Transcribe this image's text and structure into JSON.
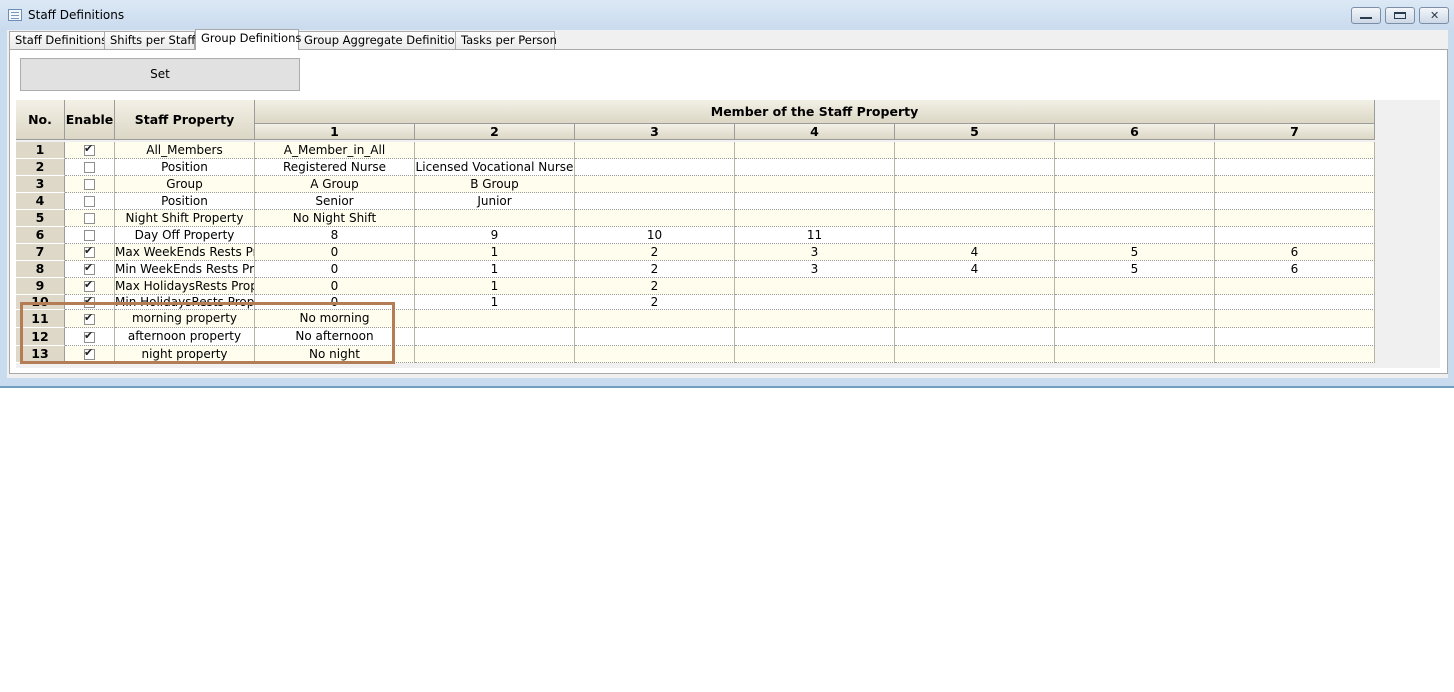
{
  "window": {
    "title": "Staff Definitions",
    "icon": "table-window-icon"
  },
  "tabs": [
    {
      "label": "Staff Definitions"
    },
    {
      "label": "Shifts per Staff"
    },
    {
      "label": "Group Definitions"
    },
    {
      "label": "Group Aggregate Definitions"
    },
    {
      "label": "Tasks per Person"
    }
  ],
  "active_tab": "Group Definitions",
  "set_button": {
    "label": "Set"
  },
  "grid": {
    "headers": {
      "no": "No.",
      "enable": "Enable",
      "property": "Staff Property",
      "members": "Member of the Staff Property"
    },
    "member_columns": [
      "1",
      "2",
      "3",
      "4",
      "5",
      "6",
      "7"
    ],
    "rows": [
      {
        "no": "1",
        "enabled": true,
        "property": "All_Members",
        "members": [
          "A_Member_in_All",
          "",
          "",
          "",
          "",
          "",
          ""
        ]
      },
      {
        "no": "2",
        "enabled": false,
        "property": "Position",
        "members": [
          "Registered Nurse",
          "Licensed Vocational Nurse",
          "",
          "",
          "",
          "",
          ""
        ]
      },
      {
        "no": "3",
        "enabled": false,
        "property": "Group",
        "members": [
          "A Group",
          "B Group",
          "",
          "",
          "",
          "",
          ""
        ]
      },
      {
        "no": "4",
        "enabled": false,
        "property": "Position",
        "members": [
          "Senior",
          "Junior",
          "",
          "",
          "",
          "",
          ""
        ]
      },
      {
        "no": "5",
        "enabled": false,
        "property": "Night Shift Property",
        "members": [
          "No Night Shift",
          "",
          "",
          "",
          "",
          "",
          ""
        ]
      },
      {
        "no": "6",
        "enabled": false,
        "property": "Day Off Property",
        "members": [
          "8",
          "9",
          "10",
          "11",
          "",
          "",
          ""
        ]
      },
      {
        "no": "7",
        "enabled": true,
        "property": "Max WeekEnds Rests Pr",
        "members": [
          "0",
          "1",
          "2",
          "3",
          "4",
          "5",
          "6"
        ]
      },
      {
        "no": "8",
        "enabled": true,
        "property": "Min WeekEnds Rests Pr",
        "members": [
          "0",
          "1",
          "2",
          "3",
          "4",
          "5",
          "6"
        ]
      },
      {
        "no": "9",
        "enabled": true,
        "property": "Max HolidaysRests Prop",
        "members": [
          "0",
          "1",
          "2",
          "",
          "",
          "",
          ""
        ]
      },
      {
        "no": "10",
        "enabled": true,
        "property": "Min HolidaysRests Prop",
        "members": [
          "0",
          "1",
          "2",
          "",
          "",
          "",
          ""
        ]
      },
      {
        "no": "11",
        "enabled": true,
        "property": "morning property",
        "members": [
          "No morning",
          "",
          "",
          "",
          "",
          "",
          ""
        ]
      },
      {
        "no": "12",
        "enabled": true,
        "property": "afternoon property",
        "members": [
          "No afternoon",
          "",
          "",
          "",
          "",
          "",
          ""
        ]
      },
      {
        "no": "13",
        "enabled": true,
        "property": "night property",
        "members": [
          "No night",
          "",
          "",
          "",
          "",
          "",
          ""
        ]
      }
    ]
  },
  "colors": {
    "highlight_border": "#b57d55",
    "header_bg": "#dcd7c5",
    "row_odd_bg": "#fffdee"
  }
}
